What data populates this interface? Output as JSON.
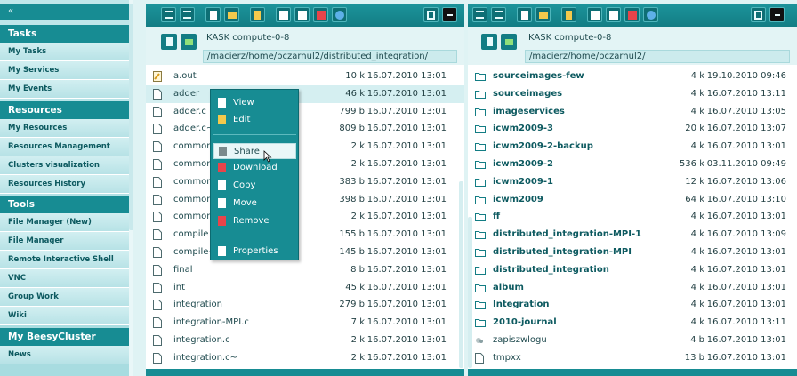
{
  "sidebar": {
    "collapse_label": "«",
    "sections": [
      {
        "title": "Tasks",
        "items": [
          "My Tasks",
          "My Services",
          "My Events"
        ]
      },
      {
        "title": "Resources",
        "items": [
          "My Resources",
          "Resources Management",
          "Clusters visualization",
          "Resources History"
        ]
      },
      {
        "title": "Tools",
        "items": [
          "File Manager (New)",
          "File Manager",
          "Remote Interactive Shell",
          "VNC",
          "Group Work",
          "Wiki"
        ]
      },
      {
        "title": "My BeesyCluster",
        "items": [
          "News"
        ]
      }
    ]
  },
  "left_panel": {
    "host": "KASK compute-0-8",
    "path": "/macierz/home/pczarnul2/distributed_integration/",
    "files": [
      {
        "name": "a.out",
        "size": "10 k",
        "date": "16.07.2010 13:01",
        "kind": "exec"
      },
      {
        "name": "adder",
        "size": "46 k",
        "date": "16.07.2010 13:01",
        "kind": "file"
      },
      {
        "name": "adder.c",
        "size": "799 b",
        "date": "16.07.2010 13:01",
        "kind": "file"
      },
      {
        "name": "adder.c~",
        "size": "809 b",
        "date": "16.07.2010 13:01",
        "kind": "file"
      },
      {
        "name": "common",
        "size": "2 k",
        "date": "16.07.2010 13:01",
        "kind": "file"
      },
      {
        "name": "common",
        "size": "2 k",
        "date": "16.07.2010 13:01",
        "kind": "file"
      },
      {
        "name": "common",
        "size": "383 b",
        "date": "16.07.2010 13:01",
        "kind": "file"
      },
      {
        "name": "common",
        "size": "398 b",
        "date": "16.07.2010 13:01",
        "kind": "file"
      },
      {
        "name": "common",
        "size": "2 k",
        "date": "16.07.2010 13:01",
        "kind": "file"
      },
      {
        "name": "compile",
        "size": "155 b",
        "date": "16.07.2010 13:01",
        "kind": "file"
      },
      {
        "name": "compile-",
        "size": "145 b",
        "date": "16.07.2010 13:01",
        "kind": "file"
      },
      {
        "name": "final",
        "size": "8 b",
        "date": "16.07.2010 13:01",
        "kind": "file"
      },
      {
        "name": "int",
        "size": "45 k",
        "date": "16.07.2010 13:01",
        "kind": "file"
      },
      {
        "name": "integration",
        "size": "279 b",
        "date": "16.07.2010 13:01",
        "kind": "file"
      },
      {
        "name": "integration-MPI.c",
        "size": "7 k",
        "date": "16.07.2010 13:01",
        "kind": "file"
      },
      {
        "name": "integration.c",
        "size": "2 k",
        "date": "16.07.2010 13:01",
        "kind": "file"
      },
      {
        "name": "integration.c~",
        "size": "2 k",
        "date": "16.07.2010 13:01",
        "kind": "file"
      }
    ]
  },
  "right_panel": {
    "host": "KASK compute-0-8",
    "path": "/macierz/home/pczarnul2/",
    "files": [
      {
        "name": "sourceimages-few",
        "size": "4 k",
        "date": "19.10.2010 09:46",
        "kind": "dir"
      },
      {
        "name": "sourceimages",
        "size": "4 k",
        "date": "16.07.2010 13:11",
        "kind": "dir"
      },
      {
        "name": "imageservices",
        "size": "4 k",
        "date": "16.07.2010 13:05",
        "kind": "dir"
      },
      {
        "name": "icwm2009-3",
        "size": "20 k",
        "date": "16.07.2010 13:07",
        "kind": "dir"
      },
      {
        "name": "icwm2009-2-backup",
        "size": "4 k",
        "date": "16.07.2010 13:01",
        "kind": "dir"
      },
      {
        "name": "icwm2009-2",
        "size": "536 k",
        "date": "03.11.2010 09:49",
        "kind": "dir"
      },
      {
        "name": "icwm2009-1",
        "size": "12 k",
        "date": "16.07.2010 13:06",
        "kind": "dir"
      },
      {
        "name": "icwm2009",
        "size": "64 k",
        "date": "16.07.2010 13:10",
        "kind": "dir"
      },
      {
        "name": "ff",
        "size": "4 k",
        "date": "16.07.2010 13:01",
        "kind": "dir"
      },
      {
        "name": "distributed_integration-MPI-1",
        "size": "4 k",
        "date": "16.07.2010 13:09",
        "kind": "dir"
      },
      {
        "name": "distributed_integration-MPI",
        "size": "4 k",
        "date": "16.07.2010 13:01",
        "kind": "dir"
      },
      {
        "name": "distributed_integration",
        "size": "4 k",
        "date": "16.07.2010 13:01",
        "kind": "dir"
      },
      {
        "name": "album",
        "size": "4 k",
        "date": "16.07.2010 13:01",
        "kind": "dir"
      },
      {
        "name": "Integration",
        "size": "4 k",
        "date": "16.07.2010 13:01",
        "kind": "dir"
      },
      {
        "name": "2010-journal",
        "size": "4 k",
        "date": "16.07.2010 13:11",
        "kind": "dir"
      },
      {
        "name": "zapiszwlogu",
        "size": "4 b",
        "date": "16.07.2010 13:01",
        "kind": "link"
      },
      {
        "name": "tmpxx",
        "size": "13 b",
        "date": "16.07.2010 13:01",
        "kind": "file"
      }
    ]
  },
  "context_menu": {
    "items": [
      "View",
      "Edit",
      "Share",
      "Download",
      "Copy",
      "Move",
      "Remove",
      "Properties"
    ],
    "highlighted": "Share"
  },
  "colors": {
    "accent": "#178c93",
    "sidebar_bg": "#b7e2e6",
    "selected_row": "#d5eff1"
  }
}
